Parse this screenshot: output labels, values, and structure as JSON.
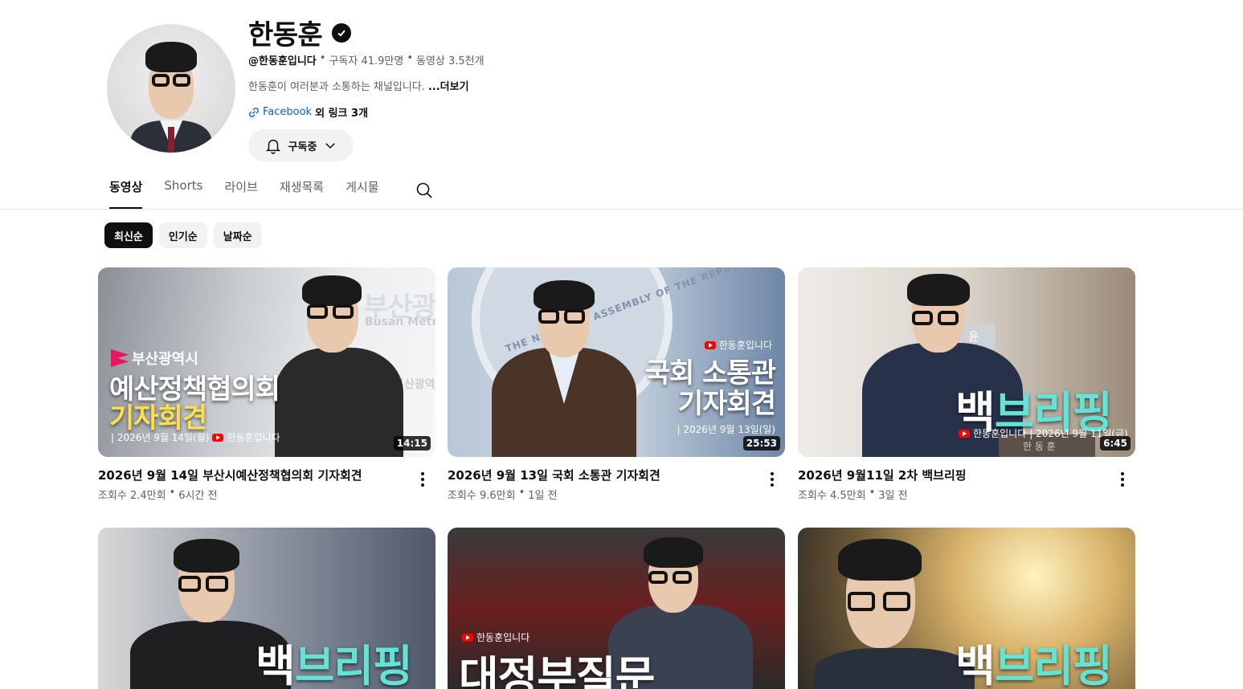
{
  "channel": {
    "name": "한동훈",
    "handle": "@한동훈입니다",
    "sep1": "•",
    "subscribers": "구독자 41.9만명",
    "sep2": "•",
    "video_count": "동영상 3.5천개",
    "description": "한동훈이 여러분과 소통하는 채널입니다.",
    "more": "...더보기",
    "link_label": "Facebook",
    "link_other": "외 링크 3개",
    "subscribe_label": "구독중"
  },
  "tabs": [
    {
      "label": "동영상"
    },
    {
      "label": "Shorts"
    },
    {
      "label": "라이브"
    },
    {
      "label": "재생목록"
    },
    {
      "label": "게시물"
    }
  ],
  "chips": [
    {
      "label": "최신순"
    },
    {
      "label": "인기순"
    },
    {
      "label": "날짜순"
    }
  ],
  "videos": [
    {
      "title": "2026년 9월 14일 부산시예산정책협의회 기자회견",
      "views": "조회수 2.4만회",
      "sep": "•",
      "age": "6시간 전",
      "duration": "14:15",
      "overlay": {
        "line0": "부산광역시",
        "line1": "예산정책협의회",
        "line2": "기자회견",
        "bg_text": "부산광",
        "bg_sub": "Busan Metro",
        "bg_side": "부산광역",
        "date": "| 2026년 9월 14일(월)",
        "brand": "한동훈입니다"
      }
    },
    {
      "title": "2026년 9월 13일 국회 소통관 기자회견",
      "views": "조회수 9.6만회",
      "sep": "•",
      "age": "1일 전",
      "duration": "25:53",
      "overlay": {
        "line1": "국회 소통관",
        "line2": "기자회견",
        "date": "| 2026년 9월 13일(일)",
        "brand": "한동훈입니다",
        "seal": "THE NATIONAL ASSEMBLY OF THE REPUBLIC OF KOREA"
      }
    },
    {
      "title": "2026년 9월11일 2차 백브리핑",
      "views": "조회수 4.5만회",
      "sep": "•",
      "age": "3일 전",
      "duration": "6:45",
      "overlay": {
        "line1a": "백",
        "line1b": "브리핑",
        "date": "| 2026년 9월 11일(금)",
        "brand": "한동훈입니다",
        "plate": "윤",
        "nameplate": "한 동 훈"
      }
    },
    {
      "overlay": {
        "line1a": "백",
        "line1b": "브리핑"
      }
    },
    {
      "overlay": {
        "line1": "대정부질문",
        "brand": "한동훈입니다"
      }
    },
    {
      "overlay": {
        "line1a": "백",
        "line1b": "브리핑"
      }
    }
  ],
  "colors": {
    "accent_cyan": "#63e3d6",
    "accent_yellow": "#ffe04a",
    "youtube_red": "#ff0000",
    "link_blue": "#065fd4"
  }
}
